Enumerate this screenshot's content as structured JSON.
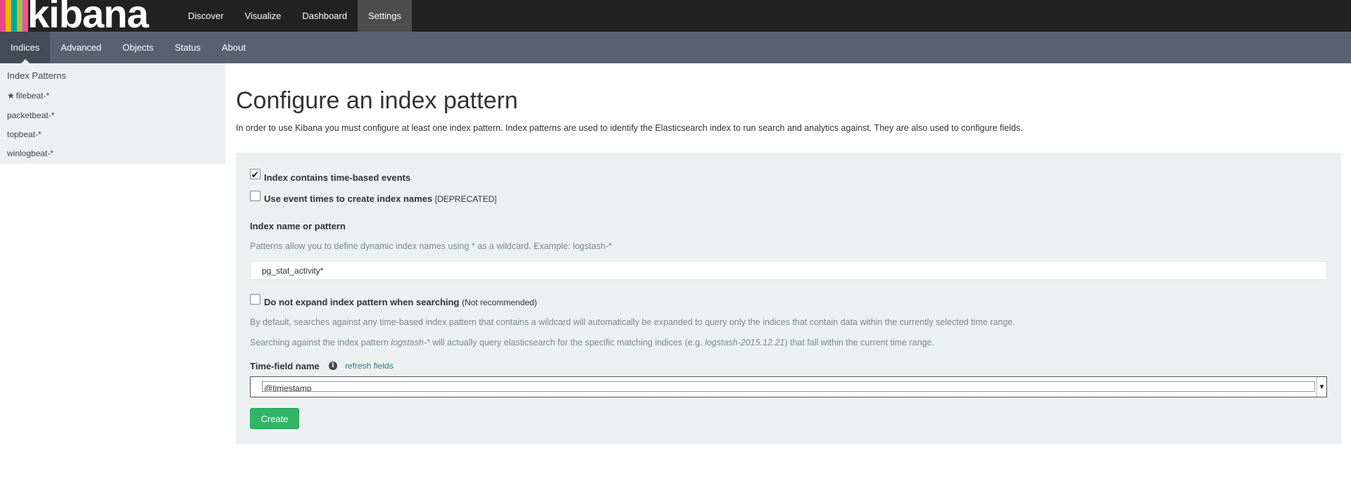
{
  "app": {
    "logo_text": "kibana",
    "logo_colors": [
      "#e8478b",
      "#f4b400",
      "#00a69b",
      "#9cc54a",
      "#ef5098"
    ]
  },
  "topnav": {
    "items": [
      {
        "label": "Discover"
      },
      {
        "label": "Visualize"
      },
      {
        "label": "Dashboard"
      },
      {
        "label": "Settings",
        "active": true
      }
    ]
  },
  "subnav": {
    "items": [
      {
        "label": "Indices",
        "active": true
      },
      {
        "label": "Advanced"
      },
      {
        "label": "Objects"
      },
      {
        "label": "Status"
      },
      {
        "label": "About"
      }
    ]
  },
  "sidebar": {
    "title": "Index Patterns",
    "patterns": [
      {
        "label": "filebeat-*",
        "default": true,
        "icon": "star-icon"
      },
      {
        "label": "packetbeat-*"
      },
      {
        "label": "topbeat-*"
      },
      {
        "label": "winlogbeat-*"
      }
    ]
  },
  "main": {
    "title": "Configure an index pattern",
    "description": "In order to use Kibana you must configure at least one index pattern. Index patterns are used to identify the Elasticsearch index to run search and analytics against. They are also used to configure fields."
  },
  "form": {
    "time_based": {
      "label": "Index contains time-based events",
      "checked": true
    },
    "event_times": {
      "label": "Use event times to create index names",
      "suffix": "[DEPRECATED]",
      "checked": false
    },
    "index_name": {
      "label": "Index name or pattern",
      "help": "Patterns allow you to define dynamic index names using * as a wildcard. Example: logstash-*",
      "value": "pg_stat_activity*"
    },
    "no_expand": {
      "label": "Do not expand index pattern when searching",
      "suffix": "(Not recommended)",
      "checked": false
    },
    "expand_help_1": "By default, searches against any time-based index pattern that contains a wildcard will automatically be expanded to query only the indices that contain data within the currently selected time range.",
    "expand_help_2": {
      "part1": "Searching against the index pattern ",
      "pattern": "logstash-*",
      "part2": " will actually query elasticsearch for the specific matching indices (e.g. ",
      "example": "logstash-2015.12.21",
      "part3": ") that fall within the current time range."
    },
    "time_field": {
      "label": "Time-field name",
      "info_icon": "info-icon",
      "refresh_label": "refresh fields",
      "selected": "@timestamp"
    },
    "create_label": "Create"
  }
}
